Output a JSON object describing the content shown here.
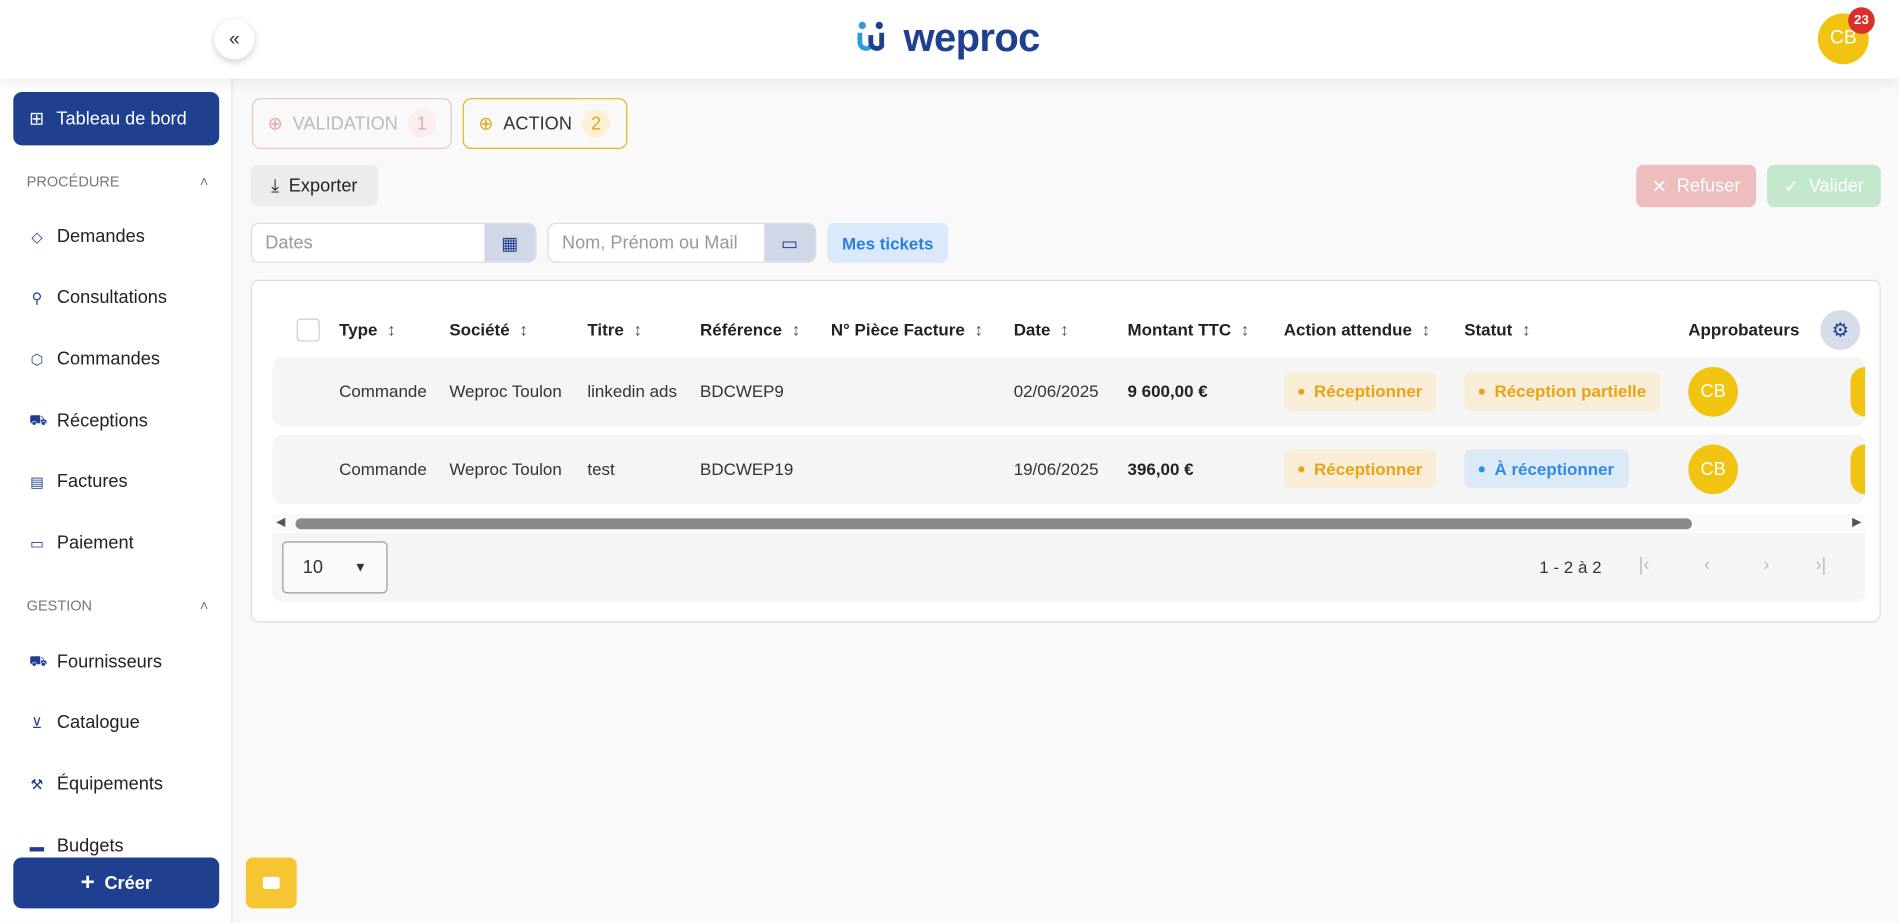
{
  "header": {
    "brand": "weproc",
    "user_initials": "CB",
    "notification_count": "23"
  },
  "sidebar": {
    "dashboard": "Tableau de bord",
    "sections": [
      {
        "title": "PROCÉDURE",
        "items": [
          "Demandes",
          "Consultations",
          "Commandes",
          "Réceptions",
          "Factures",
          "Paiement"
        ]
      },
      {
        "title": "GESTION",
        "items": [
          "Fournisseurs",
          "Catalogue",
          "Équipements",
          "Budgets"
        ]
      }
    ],
    "create": "Créer"
  },
  "tabs": [
    {
      "label": "VALIDATION",
      "count": "1"
    },
    {
      "label": "ACTION",
      "count": "2"
    }
  ],
  "toolbar": {
    "export": "Exporter",
    "refuse": "Refuser",
    "validate": "Valider"
  },
  "filters": {
    "dates_placeholder": "Dates",
    "name_placeholder": "Nom, Prénom ou Mail",
    "my_tickets": "Mes tickets"
  },
  "table": {
    "columns": [
      "Type",
      "Société",
      "Titre",
      "Référence",
      "N° Pièce Facture",
      "Date",
      "Montant TTC",
      "Action attendue",
      "Statut",
      "Approbateurs"
    ],
    "rows": [
      {
        "type": "Commande",
        "company": "Weproc Toulon",
        "title": "linkedin ads",
        "reference": "BDCWEP9",
        "invoice": "",
        "date": "02/06/2025",
        "amount": "9 600,00 €",
        "action": "Réceptionner",
        "status": "Réception partielle",
        "status_color": "#e8a317",
        "approver": "CB"
      },
      {
        "type": "Commande",
        "company": "Weproc Toulon",
        "title": "test",
        "reference": "BDCWEP19",
        "invoice": "",
        "date": "19/06/2025",
        "amount": "396,00 €",
        "action": "Réceptionner",
        "status": "À réceptionner",
        "status_color": "#2f8ae8",
        "approver": "CB"
      }
    ]
  },
  "pagination": {
    "page_size": "10",
    "range": "1 - 2 à 2"
  }
}
